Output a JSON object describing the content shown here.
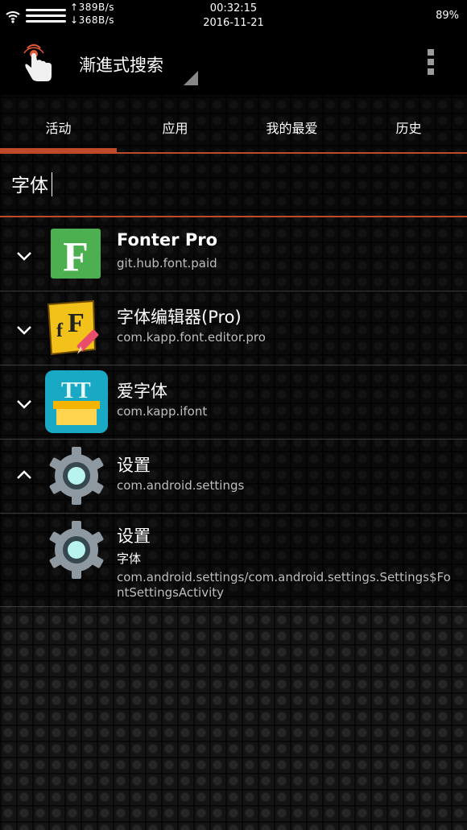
{
  "status": {
    "net_up": "389B/s",
    "net_down": "368B/s",
    "time": "00:32:15",
    "date": "2016-11-21",
    "battery": "89%"
  },
  "toolbar": {
    "title": "漸進式搜索"
  },
  "tabs": [
    {
      "label": "活动"
    },
    {
      "label": "应用"
    },
    {
      "label": "我的最爱"
    },
    {
      "label": "历史"
    }
  ],
  "selected_tab": "活动",
  "search": {
    "value": "字体"
  },
  "results": [
    {
      "name": "Fonter Pro",
      "package": "git.hub.font.paid",
      "expanded": false,
      "icon": "fonter-pro-icon"
    },
    {
      "name": "字体编辑器(Pro)",
      "package": "com.kapp.font.editor.pro",
      "expanded": false,
      "icon": "font-editor-icon"
    },
    {
      "name": "爱字体",
      "package": "com.kapp.ifont",
      "expanded": false,
      "icon": "ifont-icon"
    },
    {
      "name": "设置",
      "package": "com.android.settings",
      "expanded": true,
      "icon": "settings-gear-icon"
    }
  ],
  "activity": {
    "name": "设置",
    "label": "字体",
    "component": "com.android.settings/com.android.settings.Settings$FontSettingsActivity",
    "icon": "settings-gear-icon"
  },
  "colors": {
    "accent": "#c0492a",
    "fonter_green": "#4caf50",
    "ifont_teal": "#1aa9c4",
    "gear_gray": "#8e98a0",
    "gear_center": "#b9f3ee"
  }
}
